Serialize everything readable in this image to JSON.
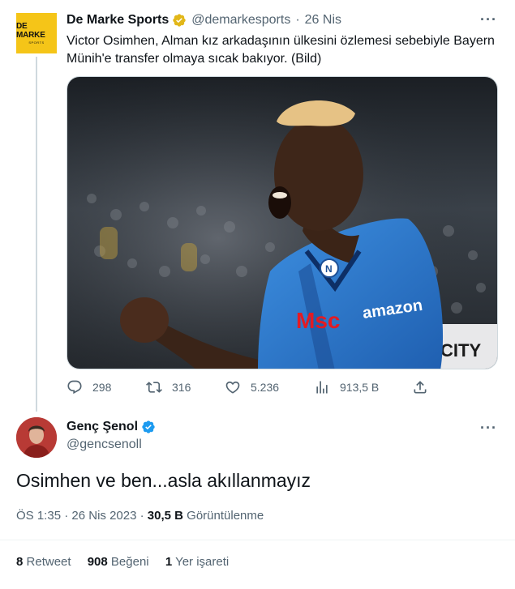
{
  "parent_tweet": {
    "avatar_text_line1": "DE MARKE",
    "avatar_text_line2": "SPORTS",
    "name": "De Marke Sports",
    "handle": "@demarkesports",
    "dot": "·",
    "date": "26 Nis",
    "more": "···",
    "text": "Victor Osimhen, Alman kız arkadaşının ülkesini özlemesi sebebiyle Bayern Münih'e transfer olmaya sıcak bakıyor. (Bild)",
    "media_jersey_brands": [
      "amazon",
      "Msc",
      "CITY"
    ],
    "actions": {
      "replies": "298",
      "retweets": "316",
      "likes": "5.236",
      "views": "913,5 B"
    }
  },
  "main_tweet": {
    "name": "Genç Şenol",
    "handle": "@gencsenoll",
    "more": "···",
    "text": "Osimhen ve ben...asla akıllanmayız",
    "time": "ÖS 1:35",
    "dot": "·",
    "date": "26 Nis 2023",
    "views_count": "30,5 B",
    "views_label": "Görüntülenme",
    "retweets_count": "8",
    "retweets_label": "Retweet",
    "likes_count": "908",
    "likes_label": "Beğeni",
    "bookmarks_count": "1",
    "bookmarks_label": "Yer işareti"
  },
  "colors": {
    "verified_gold": "#e2b719",
    "verified_blue": "#1d9bf0",
    "secondary_text": "#536471",
    "thread_line": "#cfd9de"
  }
}
